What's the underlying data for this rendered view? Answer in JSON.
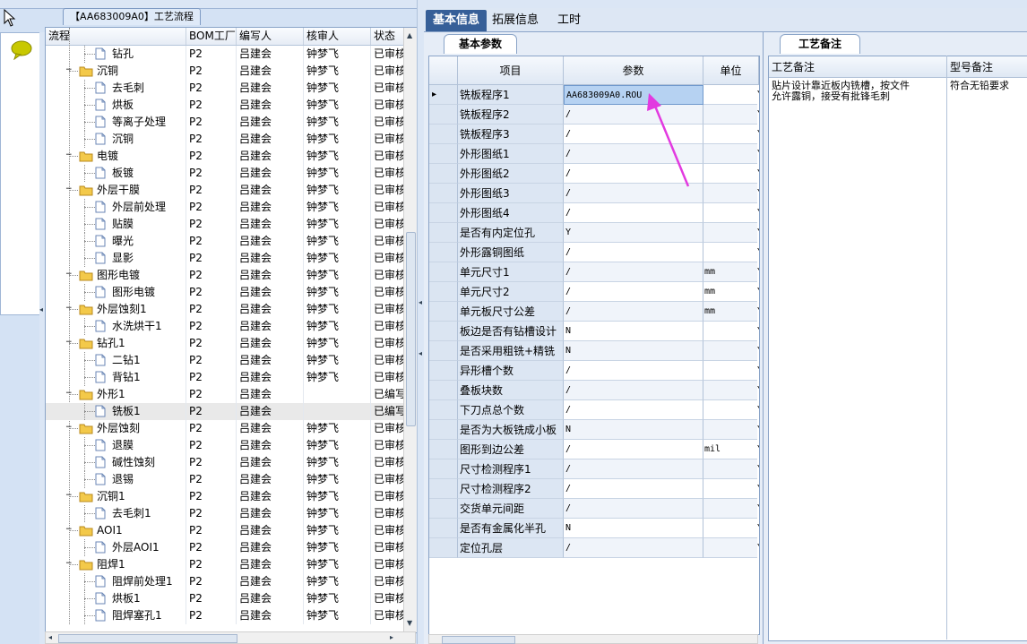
{
  "document_tab": {
    "title": "【AA683009A0】工艺流程"
  },
  "tree": {
    "columns": [
      "流程",
      "BOM工厂",
      "编写人",
      "核审人",
      "状态"
    ],
    "rows": [
      {
        "level": 1,
        "type": "doc",
        "name": "钻孔",
        "bom": "P2",
        "writer": "吕建会",
        "reviewer": "钟梦飞",
        "status": "已审核"
      },
      {
        "level": 0,
        "type": "folder",
        "name": "沉铜",
        "bom": "P2",
        "writer": "吕建会",
        "reviewer": "钟梦飞",
        "status": "已审核"
      },
      {
        "level": 1,
        "type": "doc",
        "name": "去毛刺",
        "bom": "P2",
        "writer": "吕建会",
        "reviewer": "钟梦飞",
        "status": "已审核"
      },
      {
        "level": 1,
        "type": "doc",
        "name": "烘板",
        "bom": "P2",
        "writer": "吕建会",
        "reviewer": "钟梦飞",
        "status": "已审核"
      },
      {
        "level": 1,
        "type": "doc",
        "name": "等离子处理",
        "bom": "P2",
        "writer": "吕建会",
        "reviewer": "钟梦飞",
        "status": "已审核"
      },
      {
        "level": 1,
        "type": "doc",
        "name": "沉铜",
        "bom": "P2",
        "writer": "吕建会",
        "reviewer": "钟梦飞",
        "status": "已审核"
      },
      {
        "level": 0,
        "type": "folder",
        "name": "电镀",
        "bom": "P2",
        "writer": "吕建会",
        "reviewer": "钟梦飞",
        "status": "已审核"
      },
      {
        "level": 1,
        "type": "doc",
        "name": "板镀",
        "bom": "P2",
        "writer": "吕建会",
        "reviewer": "钟梦飞",
        "status": "已审核"
      },
      {
        "level": 0,
        "type": "folder",
        "name": "外层干膜",
        "bom": "P2",
        "writer": "吕建会",
        "reviewer": "钟梦飞",
        "status": "已审核"
      },
      {
        "level": 1,
        "type": "doc",
        "name": "外层前处理",
        "bom": "P2",
        "writer": "吕建会",
        "reviewer": "钟梦飞",
        "status": "已审核"
      },
      {
        "level": 1,
        "type": "doc",
        "name": "贴膜",
        "bom": "P2",
        "writer": "吕建会",
        "reviewer": "钟梦飞",
        "status": "已审核"
      },
      {
        "level": 1,
        "type": "doc",
        "name": "曝光",
        "bom": "P2",
        "writer": "吕建会",
        "reviewer": "钟梦飞",
        "status": "已审核"
      },
      {
        "level": 1,
        "type": "doc",
        "name": "显影",
        "bom": "P2",
        "writer": "吕建会",
        "reviewer": "钟梦飞",
        "status": "已审核"
      },
      {
        "level": 0,
        "type": "folder",
        "name": "图形电镀",
        "bom": "P2",
        "writer": "吕建会",
        "reviewer": "钟梦飞",
        "status": "已审核"
      },
      {
        "level": 1,
        "type": "doc",
        "name": "图形电镀",
        "bom": "P2",
        "writer": "吕建会",
        "reviewer": "钟梦飞",
        "status": "已审核"
      },
      {
        "level": 0,
        "type": "folder",
        "name": "外层蚀刻1",
        "bom": "P2",
        "writer": "吕建会",
        "reviewer": "钟梦飞",
        "status": "已审核"
      },
      {
        "level": 1,
        "type": "doc",
        "name": "水洗烘干1",
        "bom": "P2",
        "writer": "吕建会",
        "reviewer": "钟梦飞",
        "status": "已审核"
      },
      {
        "level": 0,
        "type": "folder",
        "name": "钻孔1",
        "bom": "P2",
        "writer": "吕建会",
        "reviewer": "钟梦飞",
        "status": "已审核"
      },
      {
        "level": 1,
        "type": "doc",
        "name": "二钻1",
        "bom": "P2",
        "writer": "吕建会",
        "reviewer": "钟梦飞",
        "status": "已审核"
      },
      {
        "level": 1,
        "type": "doc",
        "name": "背钻1",
        "bom": "P2",
        "writer": "吕建会",
        "reviewer": "钟梦飞",
        "status": "已审核"
      },
      {
        "level": 0,
        "type": "folder",
        "name": "外形1",
        "bom": "P2",
        "writer": "吕建会",
        "reviewer": "",
        "status": "已编写"
      },
      {
        "level": 1,
        "type": "doc",
        "name": "铣板1",
        "bom": "P2",
        "writer": "吕建会",
        "reviewer": "",
        "status": "已编写",
        "selected": true
      },
      {
        "level": 0,
        "type": "folder",
        "name": "外层蚀刻",
        "bom": "P2",
        "writer": "吕建会",
        "reviewer": "钟梦飞",
        "status": "已审核"
      },
      {
        "level": 1,
        "type": "doc",
        "name": "退膜",
        "bom": "P2",
        "writer": "吕建会",
        "reviewer": "钟梦飞",
        "status": "已审核"
      },
      {
        "level": 1,
        "type": "doc",
        "name": "碱性蚀刻",
        "bom": "P2",
        "writer": "吕建会",
        "reviewer": "钟梦飞",
        "status": "已审核"
      },
      {
        "level": 1,
        "type": "doc",
        "name": "退锡",
        "bom": "P2",
        "writer": "吕建会",
        "reviewer": "钟梦飞",
        "status": "已审核"
      },
      {
        "level": 0,
        "type": "folder",
        "name": "沉铜1",
        "bom": "P2",
        "writer": "吕建会",
        "reviewer": "钟梦飞",
        "status": "已审核"
      },
      {
        "level": 1,
        "type": "doc",
        "name": "去毛刺1",
        "bom": "P2",
        "writer": "吕建会",
        "reviewer": "钟梦飞",
        "status": "已审核"
      },
      {
        "level": 0,
        "type": "folder",
        "name": "AOI1",
        "bom": "P2",
        "writer": "吕建会",
        "reviewer": "钟梦飞",
        "status": "已审核"
      },
      {
        "level": 1,
        "type": "doc",
        "name": "外层AOI1",
        "bom": "P2",
        "writer": "吕建会",
        "reviewer": "钟梦飞",
        "status": "已审核"
      },
      {
        "level": 0,
        "type": "folder",
        "name": "阻焊1",
        "bom": "P2",
        "writer": "吕建会",
        "reviewer": "钟梦飞",
        "status": "已审核"
      },
      {
        "level": 1,
        "type": "doc",
        "name": "阻焊前处理1",
        "bom": "P2",
        "writer": "吕建会",
        "reviewer": "钟梦飞",
        "status": "已审核"
      },
      {
        "level": 1,
        "type": "doc",
        "name": "烘板1",
        "bom": "P2",
        "writer": "吕建会",
        "reviewer": "钟梦飞",
        "status": "已审核"
      },
      {
        "level": 1,
        "type": "doc",
        "name": "阻焊塞孔1",
        "bom": "P2",
        "writer": "吕建会",
        "reviewer": "钟梦飞",
        "status": "已审核"
      }
    ]
  },
  "main_tabs": [
    {
      "label": "基本信息",
      "active": true
    },
    {
      "label": "拓展信息",
      "active": false
    },
    {
      "label": "工时",
      "active": false
    }
  ],
  "params": {
    "tab_label": "基本参数",
    "columns": [
      "项目",
      "参数",
      "单位"
    ],
    "rows": [
      {
        "item": "铣板程序1",
        "param": "AA683009A0.ROU",
        "unit": "",
        "flag": "Y",
        "selected": true
      },
      {
        "item": "铣板程序2",
        "param": "/",
        "unit": "",
        "flag": "Y"
      },
      {
        "item": "铣板程序3",
        "param": "/",
        "unit": "",
        "flag": "Y"
      },
      {
        "item": "外形图纸1",
        "param": "/",
        "unit": "",
        "flag": "Y"
      },
      {
        "item": "外形图纸2",
        "param": "/",
        "unit": "",
        "flag": "Y"
      },
      {
        "item": "外形图纸3",
        "param": "/",
        "unit": "",
        "flag": "Y"
      },
      {
        "item": "外形图纸4",
        "param": "/",
        "unit": "",
        "flag": "Y"
      },
      {
        "item": "是否有内定位孔",
        "param": "Y",
        "unit": "",
        "flag": "Y"
      },
      {
        "item": "外形露铜图纸",
        "param": "/",
        "unit": "",
        "flag": "Y"
      },
      {
        "item": "单元尺寸1",
        "param": "/",
        "unit": "mm",
        "flag": "Y"
      },
      {
        "item": "单元尺寸2",
        "param": "/",
        "unit": "mm",
        "flag": "Y"
      },
      {
        "item": "单元板尺寸公差",
        "param": "/",
        "unit": "mm",
        "flag": "Y"
      },
      {
        "item": "板边是否有钻槽设计",
        "param": "N",
        "unit": "",
        "flag": "Y"
      },
      {
        "item": "是否采用粗铣+精铣",
        "param": "N",
        "unit": "",
        "flag": "Y"
      },
      {
        "item": "异形槽个数",
        "param": "/",
        "unit": "",
        "flag": "Y"
      },
      {
        "item": "叠板块数",
        "param": "/",
        "unit": "",
        "flag": "Y"
      },
      {
        "item": "下刀点总个数",
        "param": "/",
        "unit": "",
        "flag": "Y"
      },
      {
        "item": "是否为大板铣成小板",
        "param": "N",
        "unit": "",
        "flag": "Y"
      },
      {
        "item": "图形到边公差",
        "param": "/",
        "unit": "mil",
        "flag": "Y"
      },
      {
        "item": "尺寸检测程序1",
        "param": "/",
        "unit": "",
        "flag": "Y"
      },
      {
        "item": "尺寸检测程序2",
        "param": "/",
        "unit": "",
        "flag": "Y"
      },
      {
        "item": "交货单元间距",
        "param": "/",
        "unit": "",
        "flag": "Y"
      },
      {
        "item": "是否有金属化半孔",
        "param": "N",
        "unit": "",
        "flag": "Y"
      },
      {
        "item": "定位孔层",
        "param": "/",
        "unit": "",
        "flag": "Y"
      }
    ]
  },
  "remarks": {
    "tab_label": "工艺备注",
    "col1_header": "工艺备注",
    "col2_header": "型号备注",
    "col1_text_line1": "贴片设计靠近板内铣槽，按文件",
    "col1_text_line2": "允许露铜，接受有批锋毛刺",
    "col2_text": "符合无铅要求"
  },
  "colors": {
    "active_tab": "#365f98",
    "annotation_arrow": "#e23ae0",
    "selected_cell": "#b6d2f2"
  }
}
